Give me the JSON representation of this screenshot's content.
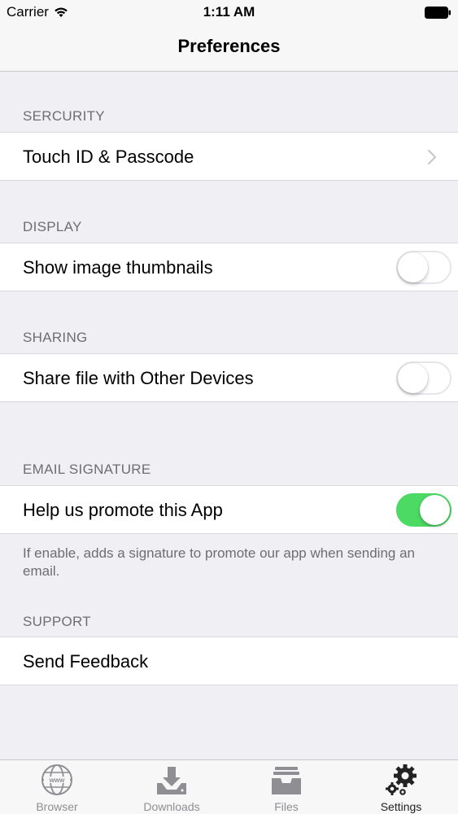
{
  "status_bar": {
    "carrier": "Carrier",
    "time": "1:11 AM"
  },
  "nav": {
    "title": "Preferences"
  },
  "sections": {
    "security": {
      "header": "SERCURITY",
      "row_label": "Touch ID & Passcode"
    },
    "display": {
      "header": "DISPLAY",
      "row_label": "Show image thumbnails",
      "toggle_on": false
    },
    "sharing": {
      "header": "SHARING",
      "row_label": "Share file with Other Devices",
      "toggle_on": false
    },
    "email_signature": {
      "header": "EMAIL SIGNATURE",
      "row_label": "Help us promote this App",
      "toggle_on": true,
      "footer": "If enable, adds a signature to promote our app when sending an email."
    },
    "support": {
      "header": "SUPPORT",
      "row_label": "Send Feedback"
    }
  },
  "tab_bar": {
    "tabs": [
      {
        "label": "Browser",
        "icon": "globe-icon",
        "active": false
      },
      {
        "label": "Downloads",
        "icon": "download-tray-icon",
        "active": false
      },
      {
        "label": "Files",
        "icon": "file-tray-icon",
        "active": false
      },
      {
        "label": "Settings",
        "icon": "gears-icon",
        "active": true
      }
    ]
  },
  "colors": {
    "toggle_on": "#4cd964",
    "background": "#efeff4",
    "section_header": "#6d6d72"
  }
}
